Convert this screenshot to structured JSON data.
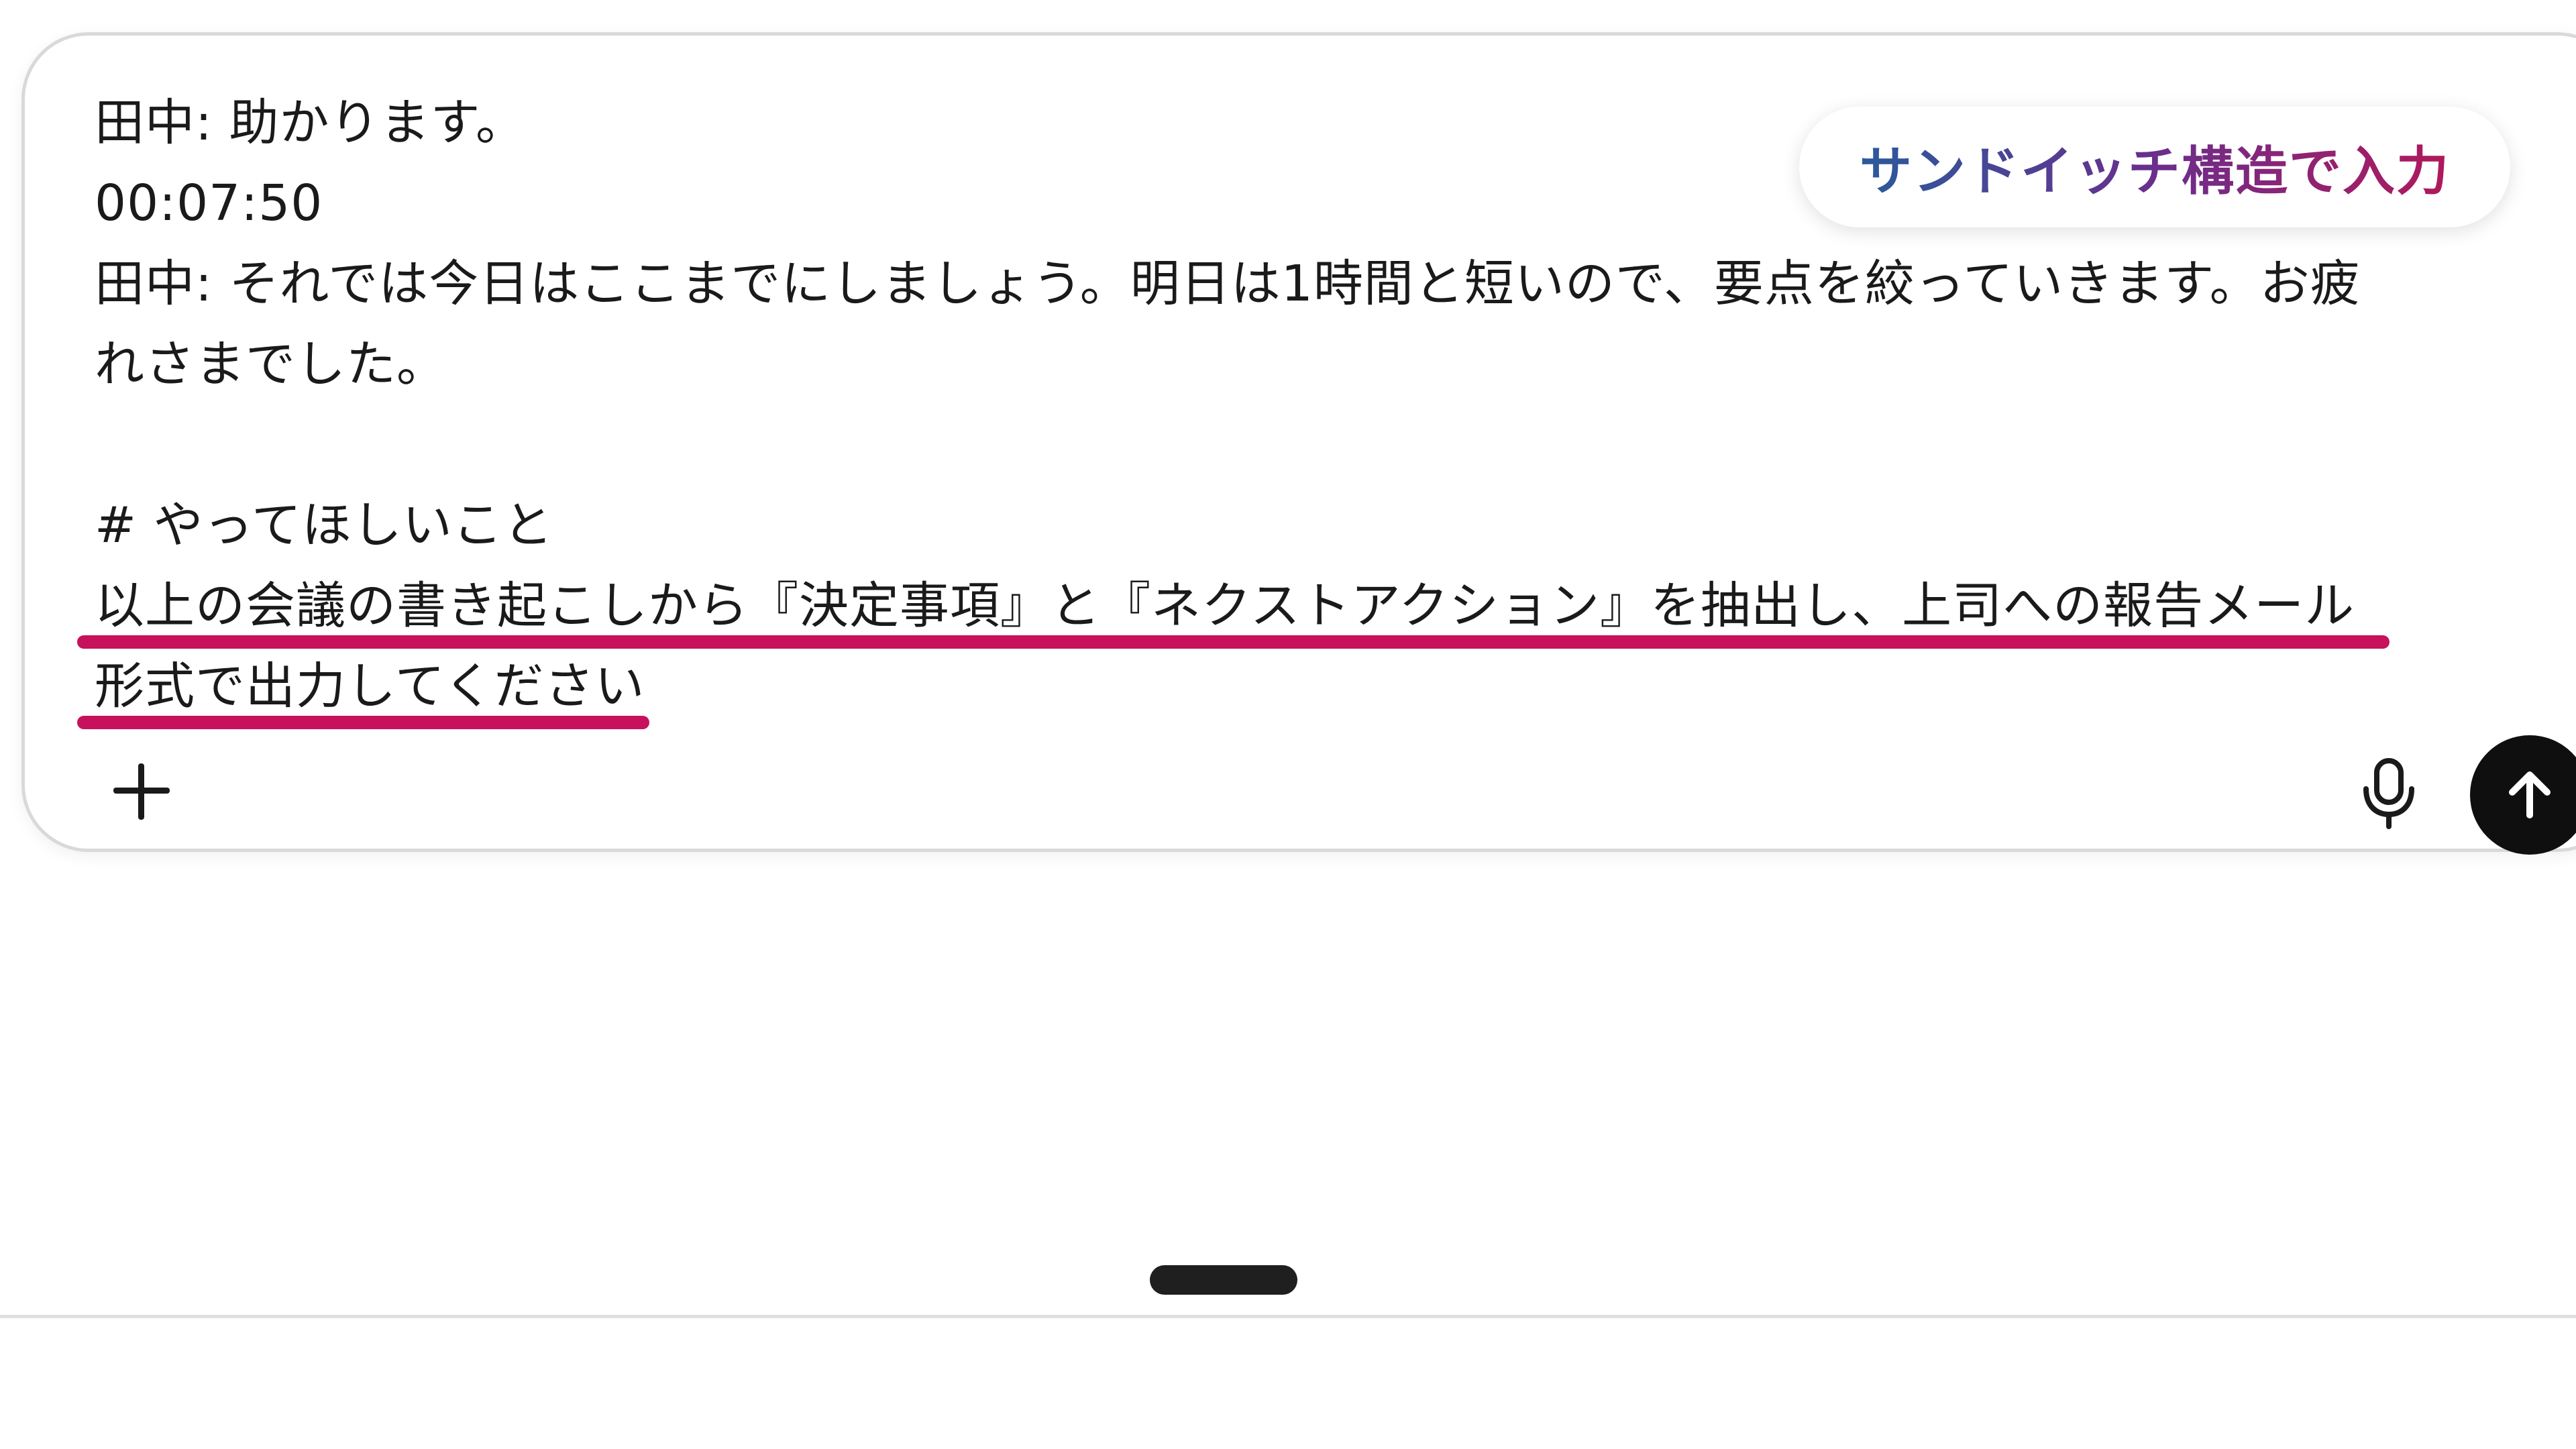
{
  "message": {
    "lines": [
      "田中: 助かります。",
      "00:07:50",
      "田中: それでは今日はここまでにしましょう。明日は1時間と短いので、要点を絞っていきます。お疲",
      "れさまでした。",
      "",
      "#  やってほしいこと",
      "以上の会議の書き起こしから『決定事項』と『ネクストアクション』を抽出し、上司への報告メール",
      "形式で出力してください"
    ]
  },
  "badge": {
    "label": "サンドイッチ構造で入力",
    "gradient_colors": [
      "#2a5a9c",
      "#6a2e8c",
      "#b1185c"
    ]
  },
  "toolbar": {
    "add_icon": "plus-icon",
    "mic_icon": "microphone-icon",
    "send_icon": "arrow-up-icon"
  },
  "colors": {
    "underline_highlight": "#c7115c",
    "send_button_bg": "#0f0f0f",
    "composer_border": "#d9d9d9"
  }
}
